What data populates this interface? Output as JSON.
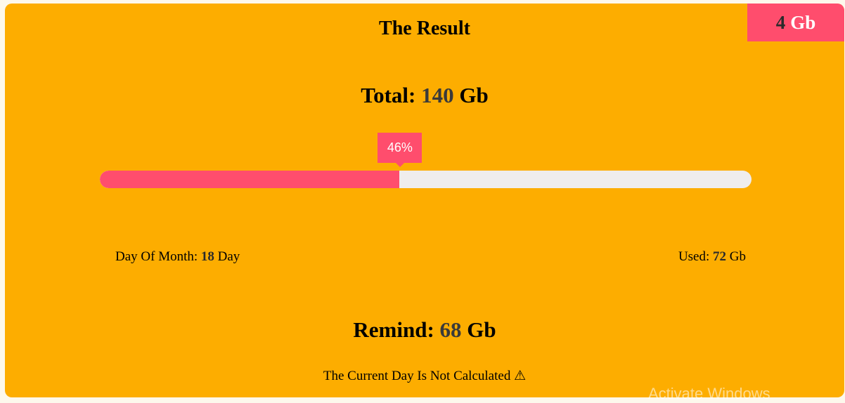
{
  "badge": {
    "value": "4",
    "unit": "Gb"
  },
  "title": "The Result",
  "total": {
    "label": "Total:",
    "value": "140",
    "unit": "Gb"
  },
  "progress": {
    "percent": 46,
    "label": "46%"
  },
  "day_of_month": {
    "label": "Day Of Month:",
    "value": "18",
    "unit": "Day"
  },
  "used": {
    "label": "Used:",
    "value": "72",
    "unit": "Gb"
  },
  "remind": {
    "label": "Remind:",
    "value": "68",
    "unit": "Gb"
  },
  "note": "The Current Day Is Not Calculated ⚠",
  "watermark": "Activate Windows",
  "colors": {
    "card": "#fdad00",
    "accent": "#ff4d6d",
    "track": "#efeded"
  }
}
